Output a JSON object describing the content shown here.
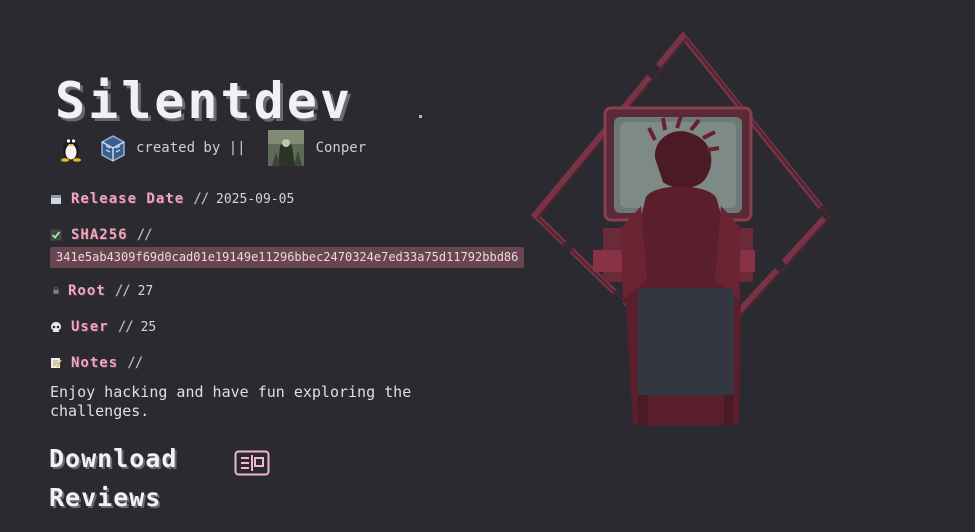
{
  "machine": {
    "name": "Silentdev",
    "os_icon": "linux-tux-icon",
    "platform_icon": "virtualbox-icon",
    "created_by_label": "created by ||",
    "author": "Conper"
  },
  "fields": {
    "release": {
      "icon": "calendar-icon",
      "label": "Release Date",
      "sep": "//",
      "value": "2025-09-05"
    },
    "sha": {
      "icon": "checkmark-icon",
      "label": "SHA256",
      "sep": "//",
      "value": "341e5ab4309f69d0cad01e19149e11296bbec2470324e7ed33a75d11792bbd86"
    },
    "root": {
      "icon": "skull-crossbones-icon",
      "label": "Root",
      "sep": "//",
      "value": "27"
    },
    "user": {
      "icon": "skull-icon",
      "label": "User",
      "sep": "//",
      "value": "25"
    },
    "notes": {
      "icon": "memo-icon",
      "label": "Notes",
      "sep": "//",
      "value": "Enjoy hacking and have fun exploring the challenges."
    }
  },
  "actions": {
    "download_label": "Download",
    "reviews_label": "Reviews"
  },
  "colors": {
    "background": "#2b2a30",
    "accent": "#efa7bb",
    "hash_bg": "#684550"
  }
}
